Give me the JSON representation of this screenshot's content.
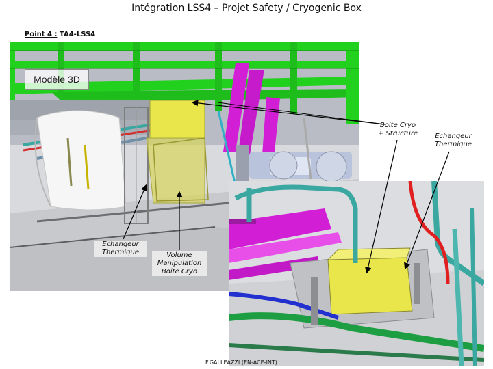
{
  "page": {
    "title": "Intégration LSS4 – Projet Safety / Cryogenic Box",
    "subtitle_prefix": "Point 4 :",
    "subtitle_rest": " TA4-LSS4",
    "footer": "F.GALLEAZZI (EN-ACE-INT)"
  },
  "model_label": "Modèle 3D",
  "annotations": {
    "boite_cryo_structure": [
      "Boite Cryo",
      "+ Structure"
    ],
    "echangeur_right": [
      "Echangeur",
      "Thermique"
    ],
    "echangeur_left": [
      "Echangeur",
      "Thermique"
    ],
    "volume_manipulation": [
      "Volume",
      "Manipulation",
      "Boite Cryo"
    ]
  },
  "colors": {
    "tray_green": "#22d11e",
    "cryo_box_yellow": "#e8e64a",
    "magenta_pipe": "#d21fd6",
    "teal_pipe": "#3aa7a0",
    "red_pipe": "#e02020",
    "blue_pipe": "#2230d0"
  }
}
